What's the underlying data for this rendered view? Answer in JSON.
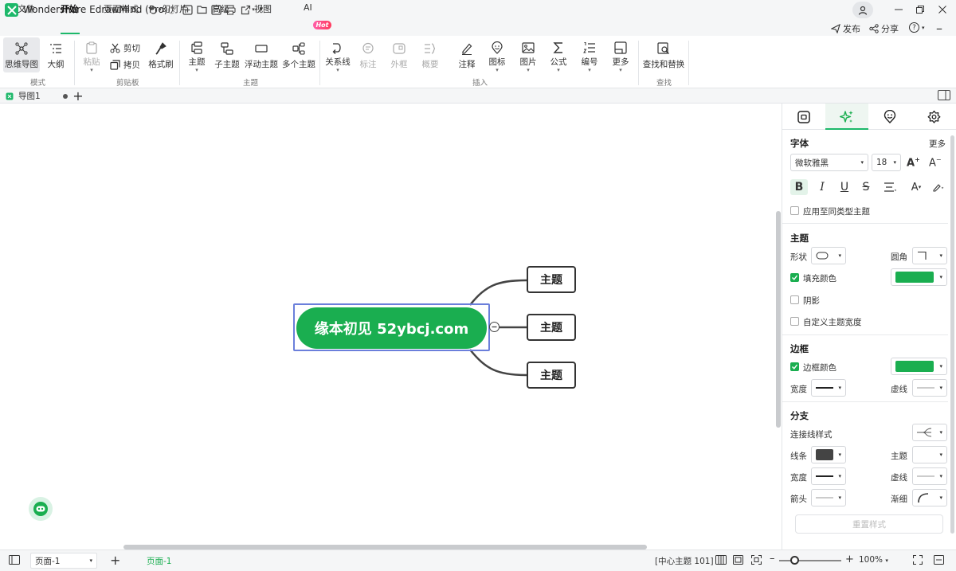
{
  "app": {
    "title": "Wondershare EdrawMind (Pro)"
  },
  "menu": {
    "items": [
      "文件",
      "开始",
      "页面样式",
      "幻灯片",
      "高级",
      "视图",
      "AI"
    ],
    "ai_badge": "Hot",
    "publish": "发布",
    "share": "分享",
    "help": "?"
  },
  "ribbon": {
    "mode": {
      "mindmap": "思维导图",
      "outline": "大纲",
      "group": "模式"
    },
    "clipboard": {
      "paste": "粘贴",
      "cut": "剪切",
      "copy": "拷贝",
      "format_painter": "格式刷",
      "group": "剪贴板"
    },
    "topic": {
      "main": "主题",
      "sub": "子主题",
      "floating": "浮动主题",
      "multiple": "多个主题",
      "group": "主题"
    },
    "insert": {
      "relation": "关系线",
      "callout": "标注",
      "boundary": "外框",
      "summary": "概要",
      "note": "注释",
      "icon": "图标",
      "image": "图片",
      "formula": "公式",
      "numbering": "编号",
      "more": "更多",
      "group": "插入"
    },
    "find": {
      "find_replace": "查找和替换",
      "group": "查找"
    }
  },
  "doc": {
    "tab": "导图1"
  },
  "canvas": {
    "central": "缘本初见 52ybcj.com",
    "topics": [
      "主题",
      "主题",
      "主题"
    ]
  },
  "panel": {
    "font": {
      "title": "字体",
      "more": "更多",
      "family": "微软雅黑",
      "size": "18",
      "apply_same": "应用至同类型主题"
    },
    "topic": {
      "title": "主题",
      "shape": "形状",
      "corner": "圆角",
      "fill": "填充颜色",
      "shadow": "阴影",
      "custom_width": "自定义主题宽度",
      "fill_color": "#1aae50"
    },
    "border": {
      "title": "边框",
      "color": "边框颜色",
      "width": "宽度",
      "dash": "虚线",
      "border_color": "#1aae50"
    },
    "branch": {
      "title": "分支",
      "connector": "连接线样式",
      "line": "线条",
      "topic": "主题",
      "width": "宽度",
      "dash": "虚线",
      "arrow": "箭头",
      "taper": "渐细",
      "line_color": "#444444"
    },
    "reset": "重置样式"
  },
  "status": {
    "page_select": "页面-1",
    "page_tab": "页面-1",
    "info": "[中心主题 101]",
    "zoom": "100%"
  }
}
